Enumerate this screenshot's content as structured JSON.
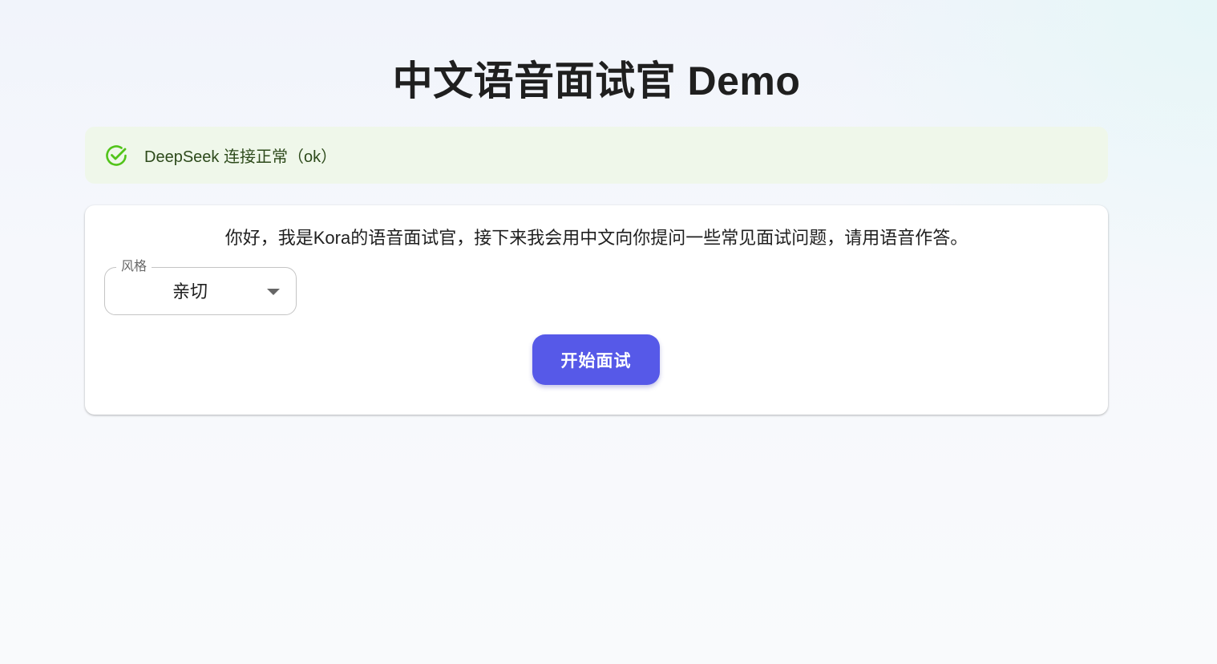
{
  "page": {
    "title": "中文语音面试官 Demo"
  },
  "status_alert": {
    "icon": "check-circle-icon",
    "message": "DeepSeek 连接正常（ok）",
    "color": "#52c41a"
  },
  "interview_card": {
    "intro": "你好，我是Kora的语音面试官，接下来我会用中文向你提问一些常见面试问题，请用语音作答。",
    "style_select": {
      "label": "风格",
      "value": "亲切",
      "icon": "caret-down-icon"
    },
    "start_button_label": "开始面试",
    "accent_color": "#5659e8"
  }
}
